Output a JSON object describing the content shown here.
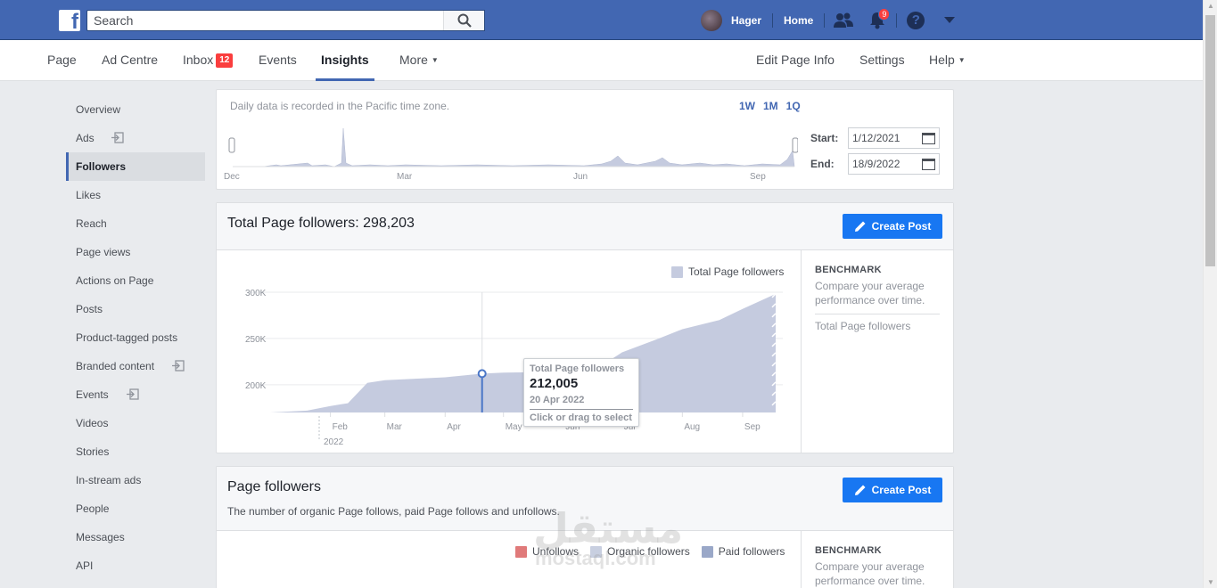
{
  "topbar": {
    "search_placeholder": "Search",
    "user_name": "Hager",
    "home_label": "Home",
    "notification_count": "9"
  },
  "pagenav": {
    "items": [
      {
        "label": "Page"
      },
      {
        "label": "Ad Centre"
      },
      {
        "label": "Inbox",
        "badge": "12"
      },
      {
        "label": "Events"
      },
      {
        "label": "Insights"
      },
      {
        "label": "More"
      }
    ],
    "right": [
      {
        "label": "Edit Page Info"
      },
      {
        "label": "Settings"
      },
      {
        "label": "Help"
      }
    ]
  },
  "sidebar": {
    "items": [
      {
        "label": "Overview"
      },
      {
        "label": "Ads"
      },
      {
        "label": "Followers"
      },
      {
        "label": "Likes"
      },
      {
        "label": "Reach"
      },
      {
        "label": "Page views"
      },
      {
        "label": "Actions on Page"
      },
      {
        "label": "Posts"
      },
      {
        "label": "Product-tagged posts"
      },
      {
        "label": "Branded content"
      },
      {
        "label": "Events"
      },
      {
        "label": "Videos"
      },
      {
        "label": "Stories"
      },
      {
        "label": "In-stream ads"
      },
      {
        "label": "People"
      },
      {
        "label": "Messages"
      },
      {
        "label": "API"
      }
    ],
    "active": "Followers"
  },
  "range": {
    "note": "Daily data is recorded in the Pacific time zone.",
    "buttons": [
      "1W",
      "1M",
      "1Q"
    ],
    "start_label": "Start:",
    "start_value": "1/12/2021",
    "end_label": "End:",
    "end_value": "18/9/2022",
    "months": [
      "Dec",
      "Mar",
      "Jun",
      "Sep"
    ]
  },
  "card1": {
    "title": "Total Page followers: 298,203",
    "create_post": "Create Post",
    "legend": "Total Page followers",
    "benchmark_title": "BENCHMARK",
    "benchmark_desc": "Compare your average performance over time.",
    "benchmark_item": "Total Page followers",
    "tooltip": {
      "label": "Total Page followers",
      "value": "212,005",
      "date": "20 Apr 2022",
      "hint": "Click or drag to select"
    }
  },
  "card2": {
    "title": "Page followers",
    "subtitle": "The number of organic Page follows, paid Page follows and unfollows.",
    "create_post": "Create Post",
    "legend": [
      {
        "name": "Unfollows",
        "color": "#e07a7a"
      },
      {
        "name": "Organic followers",
        "color": "#c8cfe0"
      },
      {
        "name": "Paid followers",
        "color": "#9aa8c8"
      }
    ],
    "benchmark_title": "BENCHMARK",
    "benchmark_desc": "Compare your average performance over time."
  },
  "watermark": {
    "arabic": "مستقل",
    "latin": "mostaql.com"
  },
  "chart_data": {
    "type": "area",
    "series": [
      {
        "name": "Total Page followers",
        "color": "#c5cbdf",
        "points": [
          [
            "2022-01-01",
            170000
          ],
          [
            "2022-01-20",
            172000
          ],
          [
            "2022-02-01",
            177000
          ],
          [
            "2022-02-10",
            180000
          ],
          [
            "2022-02-20",
            202000
          ],
          [
            "2022-03-01",
            205000
          ],
          [
            "2022-04-01",
            208000
          ],
          [
            "2022-04-20",
            212005
          ],
          [
            "2022-05-01",
            213000
          ],
          [
            "2022-06-01",
            214000
          ],
          [
            "2022-06-20",
            220000
          ],
          [
            "2022-07-01",
            235000
          ],
          [
            "2022-07-20",
            250000
          ],
          [
            "2022-08-01",
            260000
          ],
          [
            "2022-08-20",
            270000
          ],
          [
            "2022-09-01",
            282000
          ],
          [
            "2022-09-18",
            298203
          ]
        ]
      }
    ],
    "y_ticks": [
      "300K",
      "250K",
      "200K"
    ],
    "y_tick_values": [
      300000,
      250000,
      200000
    ],
    "ylim": [
      170000,
      300000
    ],
    "x_ticks": [
      "Feb",
      "Mar",
      "Apr",
      "May",
      "Jun",
      "Jul",
      "Aug",
      "Sep"
    ],
    "x_year_label": "2022",
    "grid": true,
    "legend_position": "top-right",
    "highlight": {
      "date": "2022-04-20",
      "value": 212005
    }
  }
}
